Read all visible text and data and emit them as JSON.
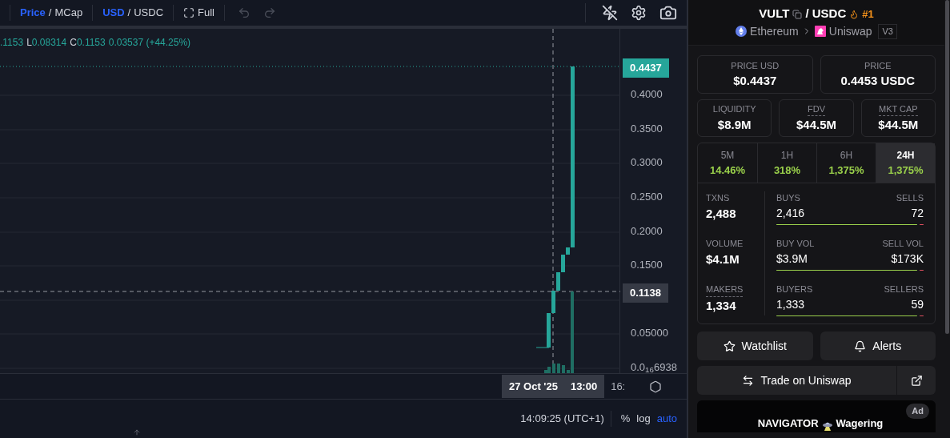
{
  "toolbar": {
    "groups": [
      {
        "primary": "Price",
        "separator": "/",
        "secondary": "MCap"
      },
      {
        "primary": "USD",
        "separator": "/",
        "secondary": "USDC"
      }
    ],
    "full_label": "Full"
  },
  "legend": {
    "parts": [
      {
        "kind": "value",
        "text": ".1153"
      },
      {
        "kind": "key",
        "text": "L"
      },
      {
        "kind": "value",
        "text": "0.08314"
      },
      {
        "kind": "key",
        "text": "C"
      },
      {
        "kind": "value",
        "text": "0.1153"
      },
      {
        "kind": "value",
        "text": "0.03537 (+44.25%)"
      }
    ]
  },
  "price_axis": {
    "ticks": [
      "0.4000",
      "0.3500",
      "0.3000",
      "0.2500",
      "0.2000",
      "0.1500",
      "0.05000",
      "0.0$_{16}$6938"
    ],
    "last_price": "0.4437",
    "crosshair_price": "0.1138"
  },
  "time_axis": {
    "crosshair_label": "27 Oct '25",
    "crosshair_time": "13:00",
    "next_tick": "16:"
  },
  "bottom_bar": {
    "clock": "14:09:25 (UTC+1)",
    "options": [
      {
        "label": "%",
        "selected": false
      },
      {
        "label": "log",
        "selected": false
      },
      {
        "label": "auto",
        "selected": true
      }
    ]
  },
  "pair": {
    "base": "VULT",
    "quote": "/ USDC",
    "rank": "#1",
    "chain": "Ethereum",
    "dex": "Uniswap",
    "version": "V3"
  },
  "price_cards": [
    {
      "label": "PRICE USD",
      "value": "$0.4437",
      "hint": false
    },
    {
      "label": "PRICE",
      "value": "0.4453 USDC",
      "hint": false
    }
  ],
  "stat_cards": [
    {
      "label": "LIQUIDITY",
      "value": "$8.9M",
      "hint": false
    },
    {
      "label": "FDV",
      "value": "$44.5M",
      "hint": true
    },
    {
      "label": "MKT CAP",
      "value": "$44.5M",
      "hint": true
    }
  ],
  "periods": [
    {
      "label": "5M",
      "change": "14.46%",
      "selected": false
    },
    {
      "label": "1H",
      "change": "318%",
      "selected": false
    },
    {
      "label": "6H",
      "change": "1,375%",
      "selected": false
    },
    {
      "label": "24H",
      "change": "1,375%",
      "selected": true
    }
  ],
  "txn_rows": [
    {
      "label": "TXNS",
      "value": "2,488",
      "hint": false,
      "buy_label": "BUYS",
      "buy_value": "2,416",
      "sell_label": "SELLS",
      "sell_value": "72",
      "level": 0.97
    },
    {
      "label": "VOLUME",
      "value": "$4.1M",
      "hint": false,
      "buy_label": "BUY VOL",
      "buy_value": "$3.9M",
      "sell_label": "SELL VOL",
      "sell_value": "$173K",
      "level": 0.96
    },
    {
      "label": "MAKERS",
      "value": "1,334",
      "hint": true,
      "buy_label": "BUYERS",
      "buy_value": "1,333",
      "sell_label": "SELLERS",
      "sell_value": "59",
      "level": 0.96
    }
  ],
  "actions": {
    "watchlist": "Watchlist",
    "alerts": "Alerts",
    "trade": "Trade on Uniswap"
  },
  "ad": {
    "title": "NAVIGATOR",
    "subtitle": "Wagering",
    "badge": "Ad"
  }
}
